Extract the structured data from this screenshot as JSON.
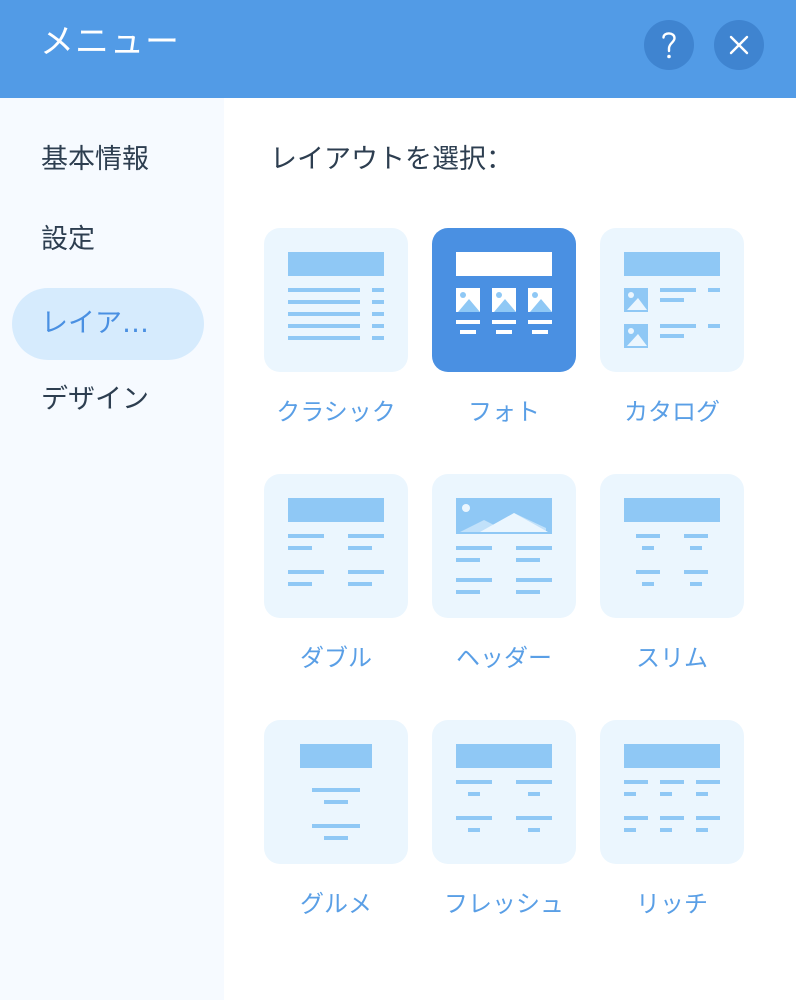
{
  "header": {
    "title": "メニュー",
    "help_icon": "question-mark-icon",
    "close_icon": "close-icon"
  },
  "sidebar": {
    "items": [
      {
        "label": "基本情報",
        "active": false
      },
      {
        "label": "設定",
        "active": false
      },
      {
        "label": "レイア…",
        "active": true
      },
      {
        "label": "デザイン",
        "active": false
      }
    ]
  },
  "main": {
    "prompt": "レイアウトを選択：",
    "layouts": [
      {
        "label": "クラシック",
        "selected": false
      },
      {
        "label": "フォト",
        "selected": true
      },
      {
        "label": "カタログ",
        "selected": false
      },
      {
        "label": "ダブル",
        "selected": false
      },
      {
        "label": "ヘッダー",
        "selected": false
      },
      {
        "label": "スリム",
        "selected": false
      },
      {
        "label": "グルメ",
        "selected": false
      },
      {
        "label": "フレッシュ",
        "selected": false
      },
      {
        "label": "リッチ",
        "selected": false
      }
    ]
  },
  "colors": {
    "header": "#529BE6",
    "accent": "#4A90E2",
    "card_bg": "#EBF6FE",
    "card_shape": "#8FC8F5",
    "sidebar_bg": "#F6FAFF",
    "active_nav_bg": "#D6EBFD",
    "text": "#2D3E50"
  }
}
